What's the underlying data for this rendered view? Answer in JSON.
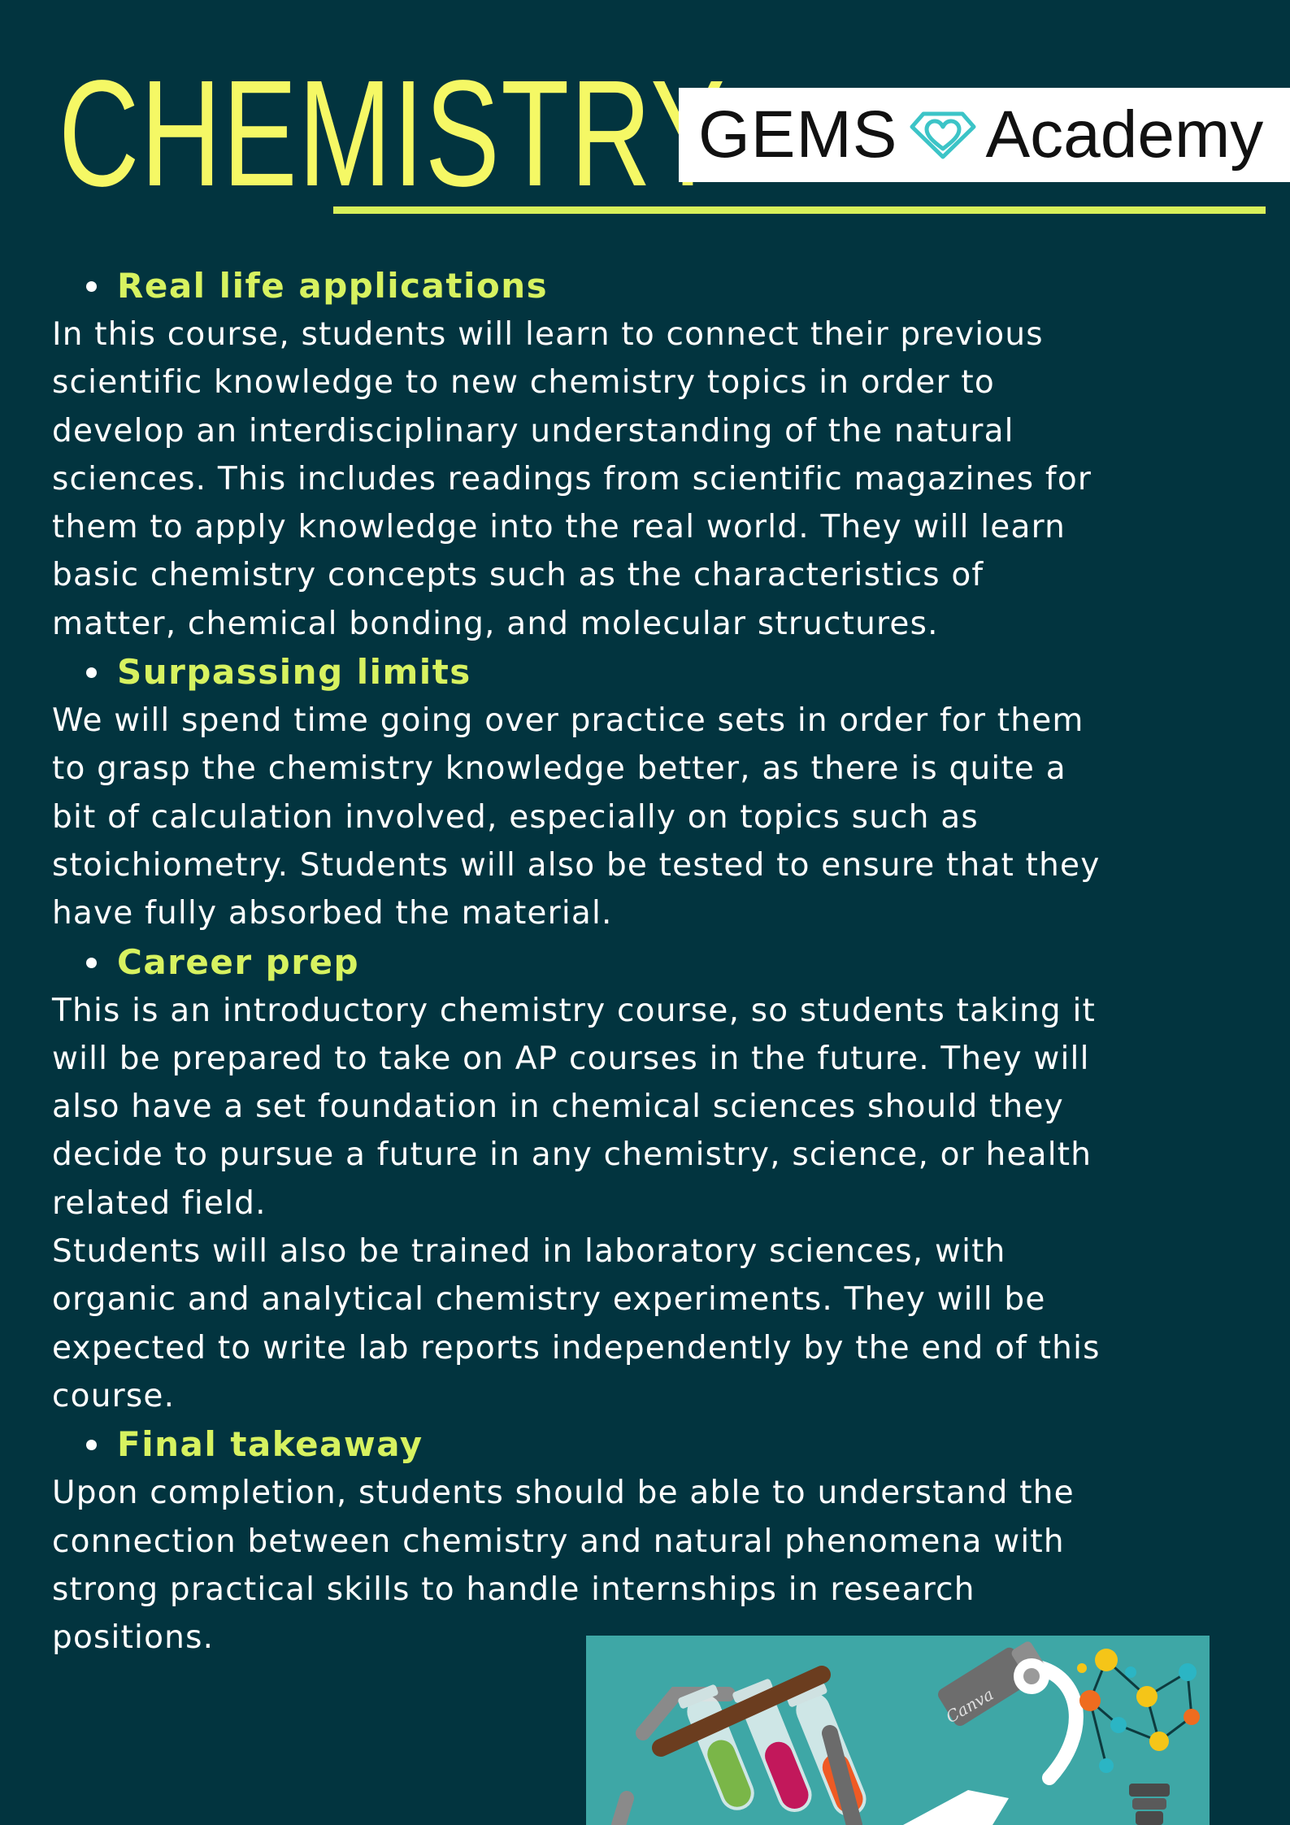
{
  "header": {
    "title": "CHEMISTRY",
    "logo_text": "GEMS Academy",
    "logo_word_1": "GEMS",
    "logo_word_2": "Academy"
  },
  "colors": {
    "background": "#02343f",
    "title": "#f5f865",
    "heading": "#d7f260",
    "rule": "#d8f05a",
    "body_text": "#ffffff",
    "logo_icon": "#3cc4c7",
    "illustration_bg": "#3ea7a6"
  },
  "sections": [
    {
      "heading": "Real life applications",
      "paragraphs": [
        {
          "lines": [
            "In this course, students will learn to connect their previous",
            "scientific knowledge to new chemistry topics in order to",
            "develop an interdisciplinary understanding of the natural",
            "sciences. This includes readings from scientific magazines for",
            "them to apply knowledge into the real world. They will learn",
            "basic chemistry concepts such as the characteristics of",
            "matter, chemical bonding, and molecular structures."
          ]
        }
      ]
    },
    {
      "heading": "Surpassing limits",
      "paragraphs": [
        {
          "lines": [
            "We will spend time going over practice sets in order for them",
            "to grasp the chemistry knowledge better, as there is quite a",
            "bit of calculation involved, especially on topics such as",
            "stoichiometry. Students will also be tested to ensure that they",
            "have fully absorbed the material."
          ]
        }
      ]
    },
    {
      "heading": "Career prep",
      "paragraphs": [
        {
          "lines": [
            "This is an introductory chemistry course, so students taking it",
            "will be prepared to take on AP courses in the future. They will",
            "also have a set foundation in chemical sciences should they",
            "decide to pursue a future in any chemistry, science, or health",
            "related field."
          ]
        },
        {
          "lines": [
            "Students will also be trained in laboratory sciences, with",
            "organic and analytical chemistry experiments. They will be",
            "expected to write lab reports independently by the end of this",
            "course."
          ]
        }
      ]
    },
    {
      "heading": "Final takeaway",
      "paragraphs": [
        {
          "lines": [
            "Upon completion, students should be able to understand the",
            "connection between chemistry and natural phenomena with",
            "strong practical skills to handle internships in research",
            "positions."
          ]
        }
      ]
    }
  ],
  "illustration": {
    "icons": [
      "test-tubes-icon",
      "microscope-icon",
      "lightbulb-molecule-icon"
    ],
    "microscope_label": "Canva"
  }
}
